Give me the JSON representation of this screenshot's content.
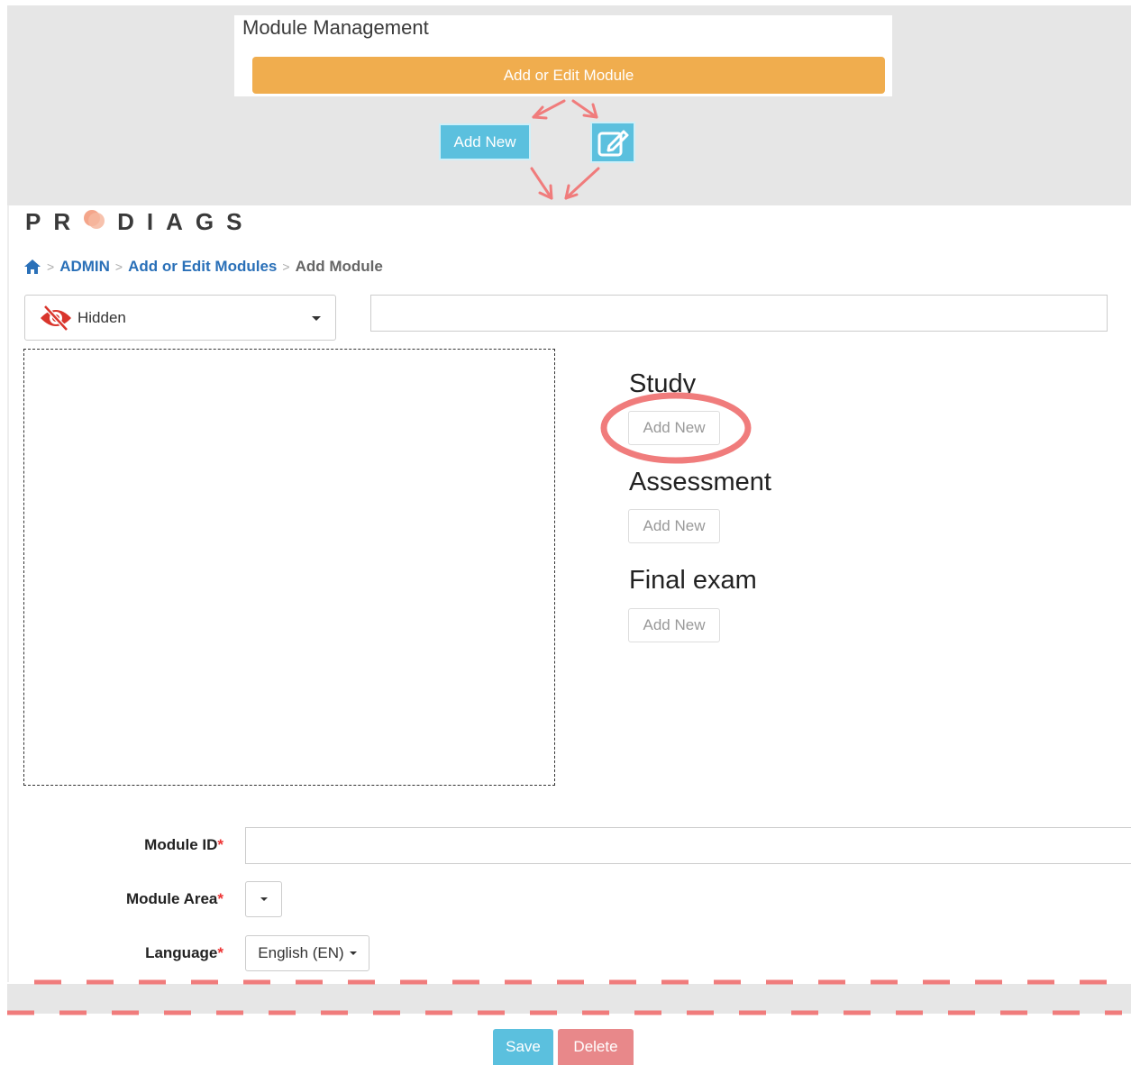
{
  "module_management": {
    "title": "Module Management",
    "bar_label": "Add or Edit Module",
    "add_new_label": "Add New"
  },
  "logo": {
    "left": "PR",
    "right": "DIAGS"
  },
  "breadcrumb": {
    "items": [
      "ADMIN",
      "Add or Edit Modules",
      "Add Module"
    ]
  },
  "visibility": {
    "selected": "Hidden"
  },
  "sections": [
    {
      "title": "Study",
      "button": "Add New"
    },
    {
      "title": "Assessment",
      "button": "Add New"
    },
    {
      "title": "Final exam",
      "button": "Add New"
    }
  ],
  "form": {
    "module_id_label": "Module ID",
    "module_area_label": "Module Area",
    "language_label": "Language",
    "required_mark": "*",
    "language_value": "English (EN)"
  },
  "actions": {
    "save": "Save",
    "delete": "Delete"
  },
  "colors": {
    "accent_orange": "#f0ad4e",
    "info_blue": "#5bc0de",
    "danger": "#e8888a",
    "annotation_red": "#f07c7c"
  }
}
